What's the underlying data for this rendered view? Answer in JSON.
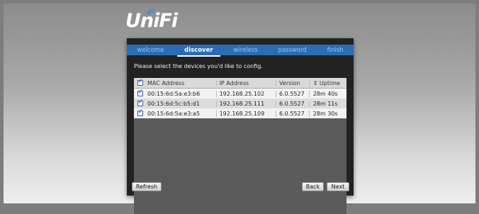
{
  "logo": {
    "text": "UniFi"
  },
  "tabs": [
    {
      "label": "welcome",
      "active": false
    },
    {
      "label": "discover",
      "active": true
    },
    {
      "label": "wireless",
      "active": false
    },
    {
      "label": "password",
      "active": false
    },
    {
      "label": "finish",
      "active": false
    }
  ],
  "instruction": "Please select the devices you'd like to config.",
  "table": {
    "headers": [
      "MAC Address",
      "IP Address",
      "Version",
      "⇕ Uptime"
    ],
    "rows": [
      {
        "mac": "00:15:6d:5a:e3:b6",
        "ip": "192.168.25.102",
        "version": "6.0.5527",
        "uptime": "28m 40s",
        "checked": true
      },
      {
        "mac": "00:15:6d:5c:b5:d1",
        "ip": "192.168.25.111",
        "version": "6.0.5527",
        "uptime": "28m 11s",
        "checked": true
      },
      {
        "mac": "00:15:6d:5a:e3:a5",
        "ip": "192.168.25.109",
        "version": "6.0.5527",
        "uptime": "28m 30s",
        "checked": true
      }
    ]
  },
  "buttons": {
    "refresh": "Refresh",
    "back": "Back",
    "next": "Next"
  },
  "colors": {
    "tab_bar": "#2b6db5",
    "panel": "#222222"
  }
}
